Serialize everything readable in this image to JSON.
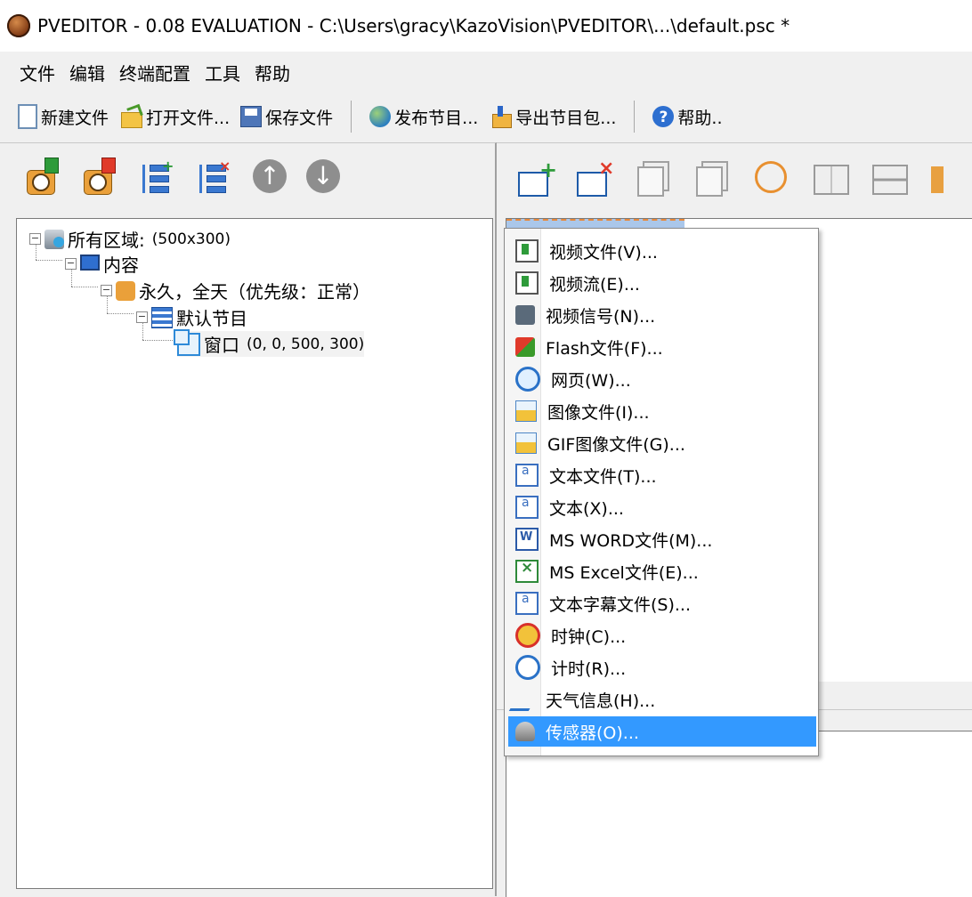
{
  "titlebar": {
    "title": "PVEDITOR - 0.08 EVALUATION - C:\\Users\\gracy\\KazoVision\\PVEDITOR\\...\\default.psc *"
  },
  "menubar": {
    "items": [
      "文件",
      "编辑",
      "终端配置",
      "工具",
      "帮助"
    ]
  },
  "toolbar": {
    "new_file": "新建文件",
    "open_file": "打开文件...",
    "save_file": "保存文件",
    "publish": "发布节目...",
    "export": "导出节目包...",
    "help": "帮助..",
    "help_glyph": "?"
  },
  "left_toolbar": {
    "move_up_glyph": "↑",
    "move_down_glyph": "↓"
  },
  "tree": {
    "all_regions": {
      "label": "所有区域:",
      "detail": "(500x300)"
    },
    "content": {
      "label": "内容"
    },
    "schedule": {
      "label": "永久，全天（优先级：正常）"
    },
    "program": {
      "label": "默认节目"
    },
    "window": {
      "label": "窗口",
      "detail": "(0, 0, 500, 300)"
    }
  },
  "context_menu": {
    "items": [
      "视频文件(V)...",
      "视频流(E)...",
      "视频信号(N)...",
      "Flash文件(F)...",
      "网页(W)...",
      "图像文件(I)...",
      "GIF图像文件(G)...",
      "文本文件(T)...",
      "文本(X)...",
      "MS WORD文件(M)...",
      "MS Excel文件(E)...",
      "文本字幕文件(S)...",
      "时钟(C)...",
      "计时(R)...",
      "天气信息(H)...",
      "传感器(O)..."
    ],
    "highlighted_index": 15
  },
  "icons": {
    "app": "app-logo-icon",
    "new_file": "new-file-icon",
    "open_file": "open-folder-icon",
    "save_file": "save-disk-icon",
    "publish": "publish-globe-icon",
    "export": "export-package-icon",
    "help": "help-icon"
  },
  "colors": {
    "highlight": "#3399ff",
    "tree_line": "#8a8a8a"
  }
}
